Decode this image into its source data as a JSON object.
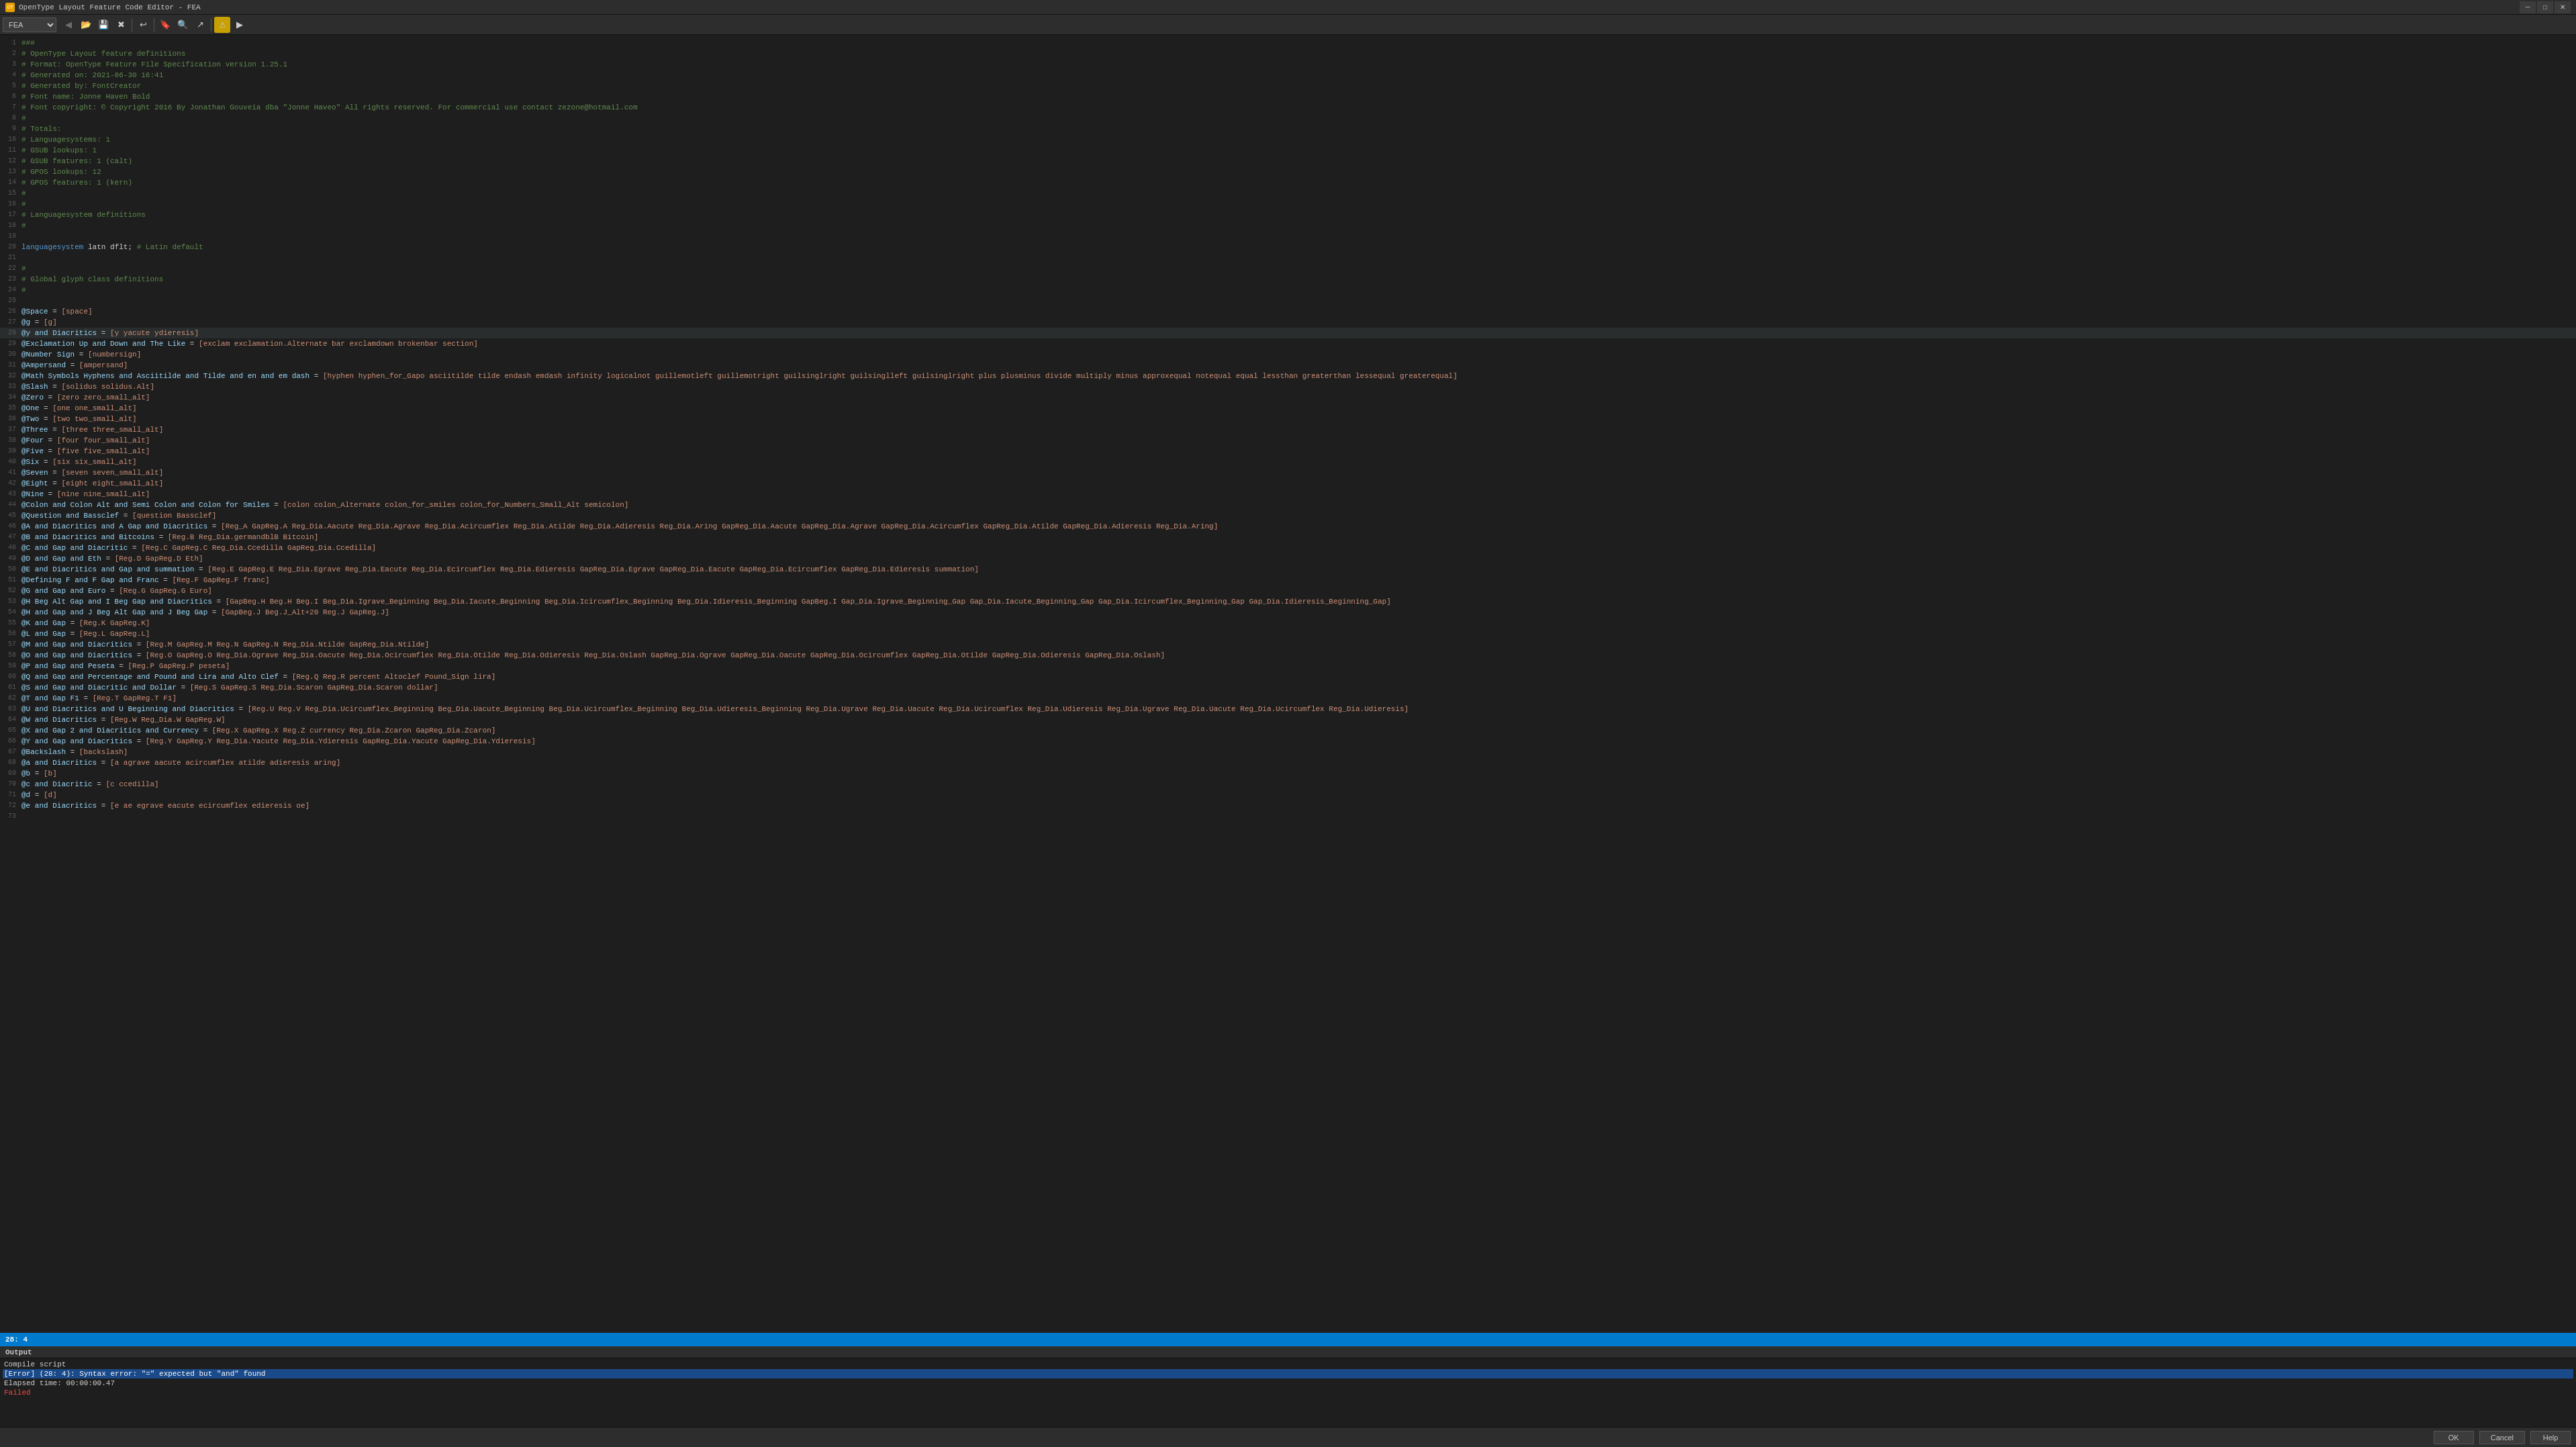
{
  "titleBar": {
    "title": "OpenType Layout Feature Code Editor - FEA",
    "appIcon": "OT"
  },
  "toolbar": {
    "dropdown": {
      "value": "FEA",
      "options": [
        "FEA"
      ]
    },
    "buttons": [
      {
        "name": "open-button",
        "icon": "📂",
        "label": "Open"
      },
      {
        "name": "save-button",
        "icon": "💾",
        "label": "Save"
      },
      {
        "name": "close-button",
        "icon": "✖",
        "label": "Close"
      },
      {
        "name": "undo-button",
        "icon": "↩",
        "label": "Undo"
      },
      {
        "name": "find-button",
        "icon": "🔍",
        "label": "Find"
      },
      {
        "name": "goto-button",
        "icon": "→",
        "label": "Go To"
      },
      {
        "name": "warning-button",
        "icon": "⚠",
        "label": "Warning"
      },
      {
        "name": "run-button",
        "icon": "▶",
        "label": "Run"
      }
    ]
  },
  "editor": {
    "lines": [
      {
        "num": 1,
        "text": "###",
        "type": "comment"
      },
      {
        "num": 2,
        "text": "# OpenType Layout feature definitions",
        "type": "comment"
      },
      {
        "num": 3,
        "text": "# Format: OpenType Feature File Specification version 1.25.1",
        "type": "comment"
      },
      {
        "num": 4,
        "text": "# Generated on: 2021-06-30 16:41",
        "type": "comment"
      },
      {
        "num": 5,
        "text": "# Generated by: FontCreator",
        "type": "comment"
      },
      {
        "num": 6,
        "text": "# Font name: Jonne Haven Bold",
        "type": "comment"
      },
      {
        "num": 7,
        "text": "# Font copyright: © Copyright 2016 By Jonathan Gouveia dba \"Jonne Haveo\" All rights reserved. For commercial use contact zezone@hotmail.com",
        "type": "comment"
      },
      {
        "num": 8,
        "text": "#",
        "type": "comment"
      },
      {
        "num": 9,
        "text": "# Totals:",
        "type": "comment"
      },
      {
        "num": 10,
        "text": "# Languagesystems: 1",
        "type": "comment"
      },
      {
        "num": 11,
        "text": "# GSUB lookups: 1",
        "type": "comment"
      },
      {
        "num": 12,
        "text": "# GSUB features: 1 (calt)",
        "type": "comment"
      },
      {
        "num": 13,
        "text": "# GPOS lookups: 12",
        "type": "comment"
      },
      {
        "num": 14,
        "text": "# GPOS features: 1 (kern)",
        "type": "comment"
      },
      {
        "num": 15,
        "text": "#",
        "type": "comment"
      },
      {
        "num": 16,
        "text": "#",
        "type": "comment"
      },
      {
        "num": 17,
        "text": "# Languagesystem definitions",
        "type": "comment"
      },
      {
        "num": 18,
        "text": "#",
        "type": "comment"
      },
      {
        "num": 19,
        "text": "",
        "type": "normal"
      },
      {
        "num": 20,
        "text": "languagesystem latn dflt; # Latin default",
        "type": "keyword"
      },
      {
        "num": 21,
        "text": "",
        "type": "normal"
      },
      {
        "num": 22,
        "text": "#",
        "type": "comment"
      },
      {
        "num": 23,
        "text": "# Global glyph class definitions",
        "type": "comment"
      },
      {
        "num": 24,
        "text": "#",
        "type": "comment"
      },
      {
        "num": 25,
        "text": "",
        "type": "normal"
      },
      {
        "num": 26,
        "text": "@Space = [space];",
        "type": "at-keyword"
      },
      {
        "num": 27,
        "text": "@g = [g];",
        "type": "at-keyword"
      },
      {
        "num": 28,
        "text": "@y and Diacritics = [y yacute ydieresis];",
        "type": "at-keyword"
      },
      {
        "num": 29,
        "text": "@Exclamation Up and Down and The Like = [exclam exclamation.Alternate bar exclamdown brokenbar section];",
        "type": "at-keyword"
      },
      {
        "num": 30,
        "text": "@Number Sign = [numbersign];",
        "type": "at-keyword"
      },
      {
        "num": 31,
        "text": "@Ampersand = [ampersand];",
        "type": "at-keyword"
      },
      {
        "num": 32,
        "text": "@Math Symbols Hyphens and Asciitilde and Tilde and en and em dash = [hyphen hyphen_for_Gapo asciitilde tilde endash emdash infinity logicalnot guillemotleft guillemotright guilsinglright guilsinglleft guilsinglright plus plusminus divide multiply minus approxequal notequal equal lessthan greaterthan lessequal greaterequal];",
        "type": "at-keyword"
      },
      {
        "num": 33,
        "text": "@Slash = [solidus solidus.Alt];",
        "type": "at-keyword"
      },
      {
        "num": 34,
        "text": "@Zero = [zero zero_small_alt];",
        "type": "at-keyword"
      },
      {
        "num": 35,
        "text": "@One = [one one_small_alt];",
        "type": "at-keyword"
      },
      {
        "num": 36,
        "text": "@Two = [two two_small_alt];",
        "type": "at-keyword"
      },
      {
        "num": 37,
        "text": "@Three = [three three_small_alt];",
        "type": "at-keyword"
      },
      {
        "num": 38,
        "text": "@Four = [four four_small_alt];",
        "type": "at-keyword"
      },
      {
        "num": 39,
        "text": "@Five = [five five_small_alt];",
        "type": "at-keyword"
      },
      {
        "num": 40,
        "text": "@Six = [six six_small_alt];",
        "type": "at-keyword"
      },
      {
        "num": 41,
        "text": "@Seven = [seven seven_small_alt];",
        "type": "at-keyword"
      },
      {
        "num": 42,
        "text": "@Eight = [eight eight_small_alt];",
        "type": "at-keyword"
      },
      {
        "num": 43,
        "text": "@Nine = [nine nine_small_alt];",
        "type": "at-keyword"
      },
      {
        "num": 44,
        "text": "@Colon and Colon Alt and Semi Colon and Colon for Smiles = [colon colon_Alternate colon_for_smiles colon_for_Numbers_Small_Alt semicolon];",
        "type": "at-keyword"
      },
      {
        "num": 45,
        "text": "@Question and Bassclef = [question Bassclef];",
        "type": "at-keyword"
      },
      {
        "num": 46,
        "text": "@A and Diacritics and A Gap and Diacritics = [Reg_A GapReg.A Reg_Dia.Aacute Reg_Dia.Agrave Reg_Dia.Acircumflex Reg_Dia.Atilde Reg_Dia.Adieresis Reg_Dia.Aring GapReg_Dia.Aacute GapReg_Dia.Agrave GapReg_Dia.Acircumflex GapReg_Dia.Atilde GapReg_Dia.Adieresis Reg_Dia.Aring];",
        "type": "at-keyword"
      },
      {
        "num": 47,
        "text": "@B and Diacritics and Bitcoins = [Reg.B Reg_Dia.germandblB Bitcoin];",
        "type": "at-keyword"
      },
      {
        "num": 48,
        "text": "@C and Gap and Diacritic = [Reg.C GapReg.C Reg_Dia.Ccedilla GapReg_Dia.Ccedilla];",
        "type": "at-keyword"
      },
      {
        "num": 49,
        "text": "@D and Gap and Eth = [Reg.D GapReg.D Eth];",
        "type": "at-keyword"
      },
      {
        "num": 50,
        "text": "@E and Diacritics and Gap and summation = [Reg.E GapReg.E Reg_Dia.Egrave Reg_Dia.Eacute Reg_Dia.Ecircumflex Reg_Dia.Edieresis GapReg_Dia.Egrave GapReg_Dia.Eacute GapReg_Dia.Ecircumflex GapReg_Dia.Edieresis summation];",
        "type": "at-keyword"
      },
      {
        "num": 51,
        "text": "@Defining F and F Gap and Franc = [Reg.F GapReg.F franc];",
        "type": "at-keyword"
      },
      {
        "num": 52,
        "text": "@G and Gap and Euro = [Reg.G GapReg.G Euro];",
        "type": "at-keyword"
      },
      {
        "num": 53,
        "text": "@H Beg Alt Gap and I Beg Gap and Diacritics = [GapBeg.H Beg.H Beg.I Beg_Dia.Igrave_Beginning Beg_Dia.Iacute_Beginning Beg_Dia.Icircumflex_Beginning Beg_Dia.Idieresis_Beginning GapBeg.I Gap_Dia.Igrave_Beginning_Gap Gap_Dia.Iacute_Beginning_Gap Gap_Dia.Icircumflex_Beginning_Gap Gap_Dia.Idieresis_Beginning_Gap];",
        "type": "at-keyword"
      },
      {
        "num": 54,
        "text": "@H and Gap and J Beg Alt Gap and J Beg Gap = [GapBeg.J Beg.J_Alt+20 Reg.J GapReg.J];",
        "type": "at-keyword"
      },
      {
        "num": 55,
        "text": "@K and Gap = [Reg.K GapReg.K];",
        "type": "at-keyword"
      },
      {
        "num": 56,
        "text": "@L and Gap = [Reg.L GapReg.L];",
        "type": "at-keyword"
      },
      {
        "num": 57,
        "text": "@M and Gap and Diacritics = [Reg.M GapReg.M Reg.N GapReg.N Reg_Dia.Ntilde GapReg_Dia.Ntilde];",
        "type": "at-keyword"
      },
      {
        "num": 58,
        "text": "@O and Gap and Diacritics = [Reg.O GapReg.O Reg_Dia.Ograve Reg_Dia.Oacute Reg_Dia.Ocircumflex Reg_Dia.Otilde Reg_Dia.Odieresis Reg_Dia.Oslash GapReg_Dia.Ograve GapReg_Dia.Oacute GapReg_Dia.Ocircumflex GapReg_Dia.Otilde GapReg_Dia.Odieresis GapReg_Dia.Oslash];",
        "type": "at-keyword"
      },
      {
        "num": 59,
        "text": "@P and Gap and Peseta = [Reg.P GapReg.P peseta];",
        "type": "at-keyword"
      },
      {
        "num": 60,
        "text": "@Q and Gap and Percentage and Pound and Lira and Alto Clef = [Reg.Q Reg.R percent Altoclef Pound_Sign lira];",
        "type": "at-keyword"
      },
      {
        "num": 61,
        "text": "@S and Gap and Diacritic and Dollar = [Reg.S GapReg.S Reg_Dia.Scaron GapReg_Dia.Scaron dollar];",
        "type": "at-keyword"
      },
      {
        "num": 62,
        "text": "@T and Gap F1 = [Reg.T GapReg.T F1];",
        "type": "at-keyword"
      },
      {
        "num": 63,
        "text": "@U and Diacritics and U Beginning and Diacritics = [Reg.U Reg.V Reg_Dia.Ucircumflex_Beginning Beg_Dia.Uacute_Beginning Beg_Dia.Ucircumflex_Beginning Beg_Dia.Udieresis_Beginning Reg_Dia.Ugrave Reg_Dia.Uacute Reg_Dia.Ucircumflex Reg_Dia.Udieresis Reg_Dia.Ugrave Reg_Dia.Uacute Reg_Dia.Ucircumflex Reg_Dia.Udieresis];",
        "type": "at-keyword"
      },
      {
        "num": 64,
        "text": "@W and Diacritics = [Reg.W Reg_Dia.W GapReg.W];",
        "type": "at-keyword"
      },
      {
        "num": 65,
        "text": "@X and Gap 2 and Diacritics and Currency = [Reg.X GapReg.X Reg.Z currency Reg_Dia.Zcaron GapReg_Dia.Zcaron];",
        "type": "at-keyword"
      },
      {
        "num": 66,
        "text": "@Y and Gap and Diacritics = [Reg.Y GapReg.Y Reg_Dia.Yacute Reg_Dia.Ydieresis GapReg_Dia.Yacute GapReg_Dia.Ydieresis];",
        "type": "at-keyword"
      },
      {
        "num": 67,
        "text": "@Backslash = [backslash];",
        "type": "at-keyword"
      },
      {
        "num": 68,
        "text": "@a and Diacritics = [a agrave aacute acircumflex atilde adieresis aring];",
        "type": "at-keyword"
      },
      {
        "num": 69,
        "text": "@b = [b];",
        "type": "at-keyword"
      },
      {
        "num": 70,
        "text": "@c and Diacritic = [c ccedilla];",
        "type": "at-keyword"
      },
      {
        "num": 71,
        "text": "@d = [d];",
        "type": "at-keyword"
      },
      {
        "num": 72,
        "text": "@e and Diacritics = [e ae egrave eacute ecircumflex edieresis oe];",
        "type": "at-keyword"
      },
      {
        "num": 73,
        "text": "",
        "type": "normal"
      }
    ]
  },
  "statusBar": {
    "cursorPosition": "28: 4"
  },
  "outputPanel": {
    "title": "Output",
    "lines": [
      {
        "text": "Compile script",
        "type": "normal"
      },
      {
        "text": "[Error] (28: 4): Syntax error: \"=\" expected but \"and\" found",
        "type": "error"
      },
      {
        "text": "Elapsed time: 00:00:00.47",
        "type": "timing"
      },
      {
        "text": "Failed",
        "type": "failed"
      }
    ]
  },
  "bottomBar": {
    "buttons": [
      {
        "name": "ok-button",
        "label": "OK"
      },
      {
        "name": "cancel-button",
        "label": "Cancel"
      },
      {
        "name": "help-button",
        "label": "Help"
      }
    ]
  },
  "windowControls": {
    "minimize": "─",
    "maximize": "□",
    "close": "✕"
  }
}
